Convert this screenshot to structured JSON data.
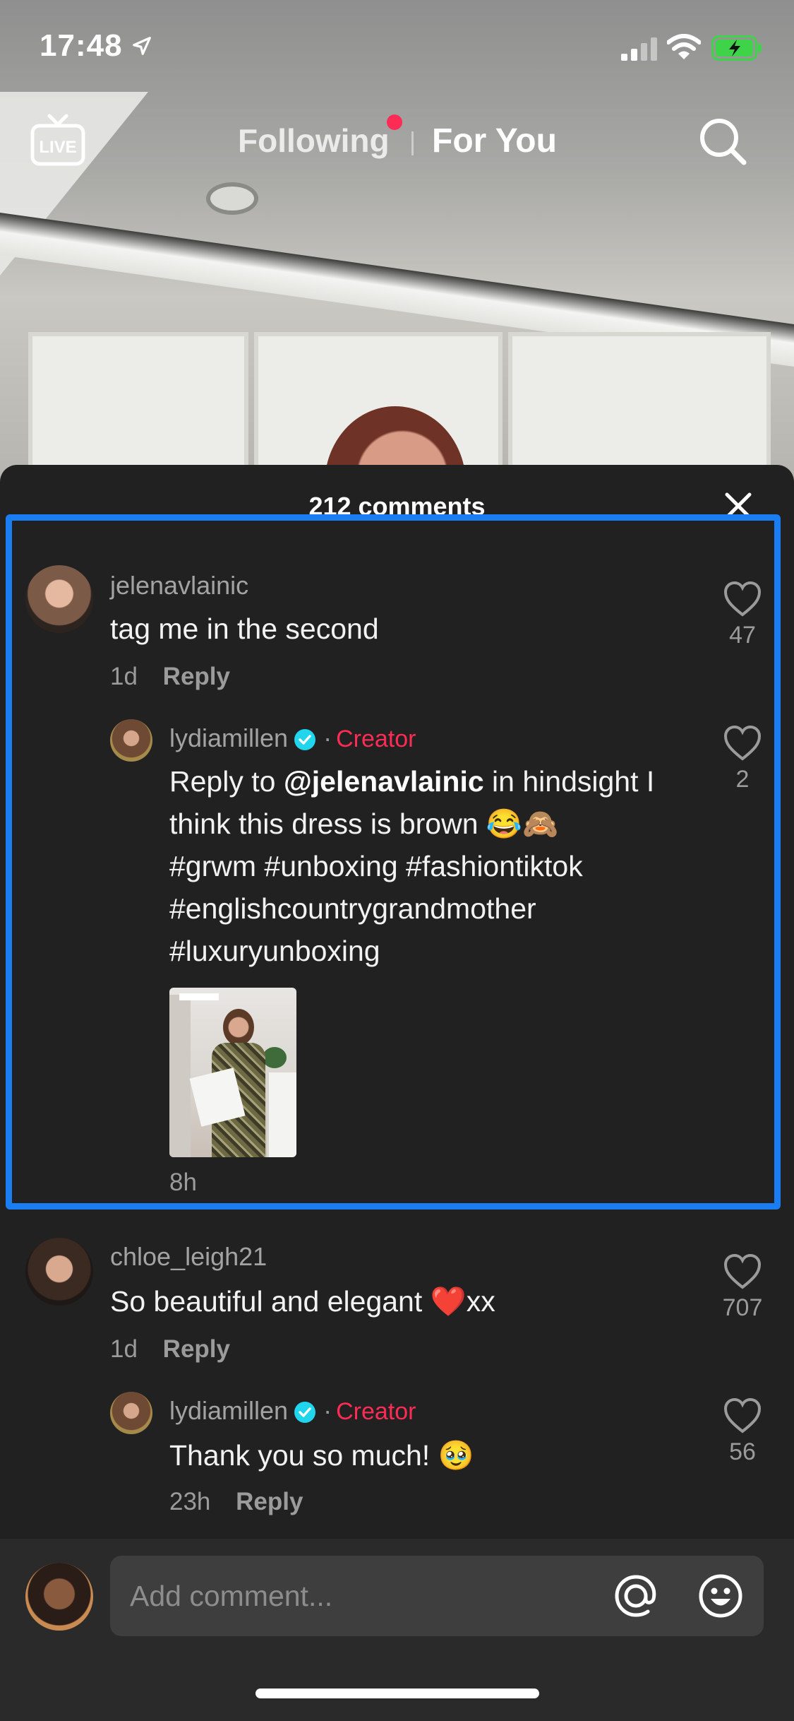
{
  "status_bar": {
    "time": "17:48"
  },
  "top_nav": {
    "tab_following": "Following",
    "tab_for_you": "For You",
    "live_label": "LIVE"
  },
  "comments": {
    "count_label": "212 comments",
    "thread": [
      {
        "username": "jelenavlainic",
        "text": "tag me in the second",
        "age": "1d",
        "reply_label": "Reply",
        "likes": "47",
        "replies": [
          {
            "username": "lydiamillen",
            "badge": "Creator",
            "prefix": "Reply to ",
            "mention": "@jelenavlainic",
            "text_lines": [
              " in hindsight I",
              "think this dress is brown 😂🙈",
              "#grwm #unboxing #fashiontiktok",
              "#englishcountrygrandmother",
              "#luxuryunboxing"
            ],
            "age": "8h",
            "likes": "2"
          }
        ]
      },
      {
        "username": "chloe_leigh21",
        "text": "So beautiful and elegant ❤️xx",
        "age": "1d",
        "reply_label": "Reply",
        "likes": "707",
        "replies": [
          {
            "username": "lydiamillen",
            "badge": "Creator",
            "text": "Thank you so much! 🥹",
            "age": "23h",
            "reply_label": "Reply",
            "likes": "56"
          }
        ]
      }
    ]
  },
  "input": {
    "placeholder": "Add comment..."
  },
  "colors": {
    "accent": "#fe2c55",
    "highlight": "#1a7df2",
    "sheet_bg": "#212121",
    "verified": "#20d5ec"
  }
}
